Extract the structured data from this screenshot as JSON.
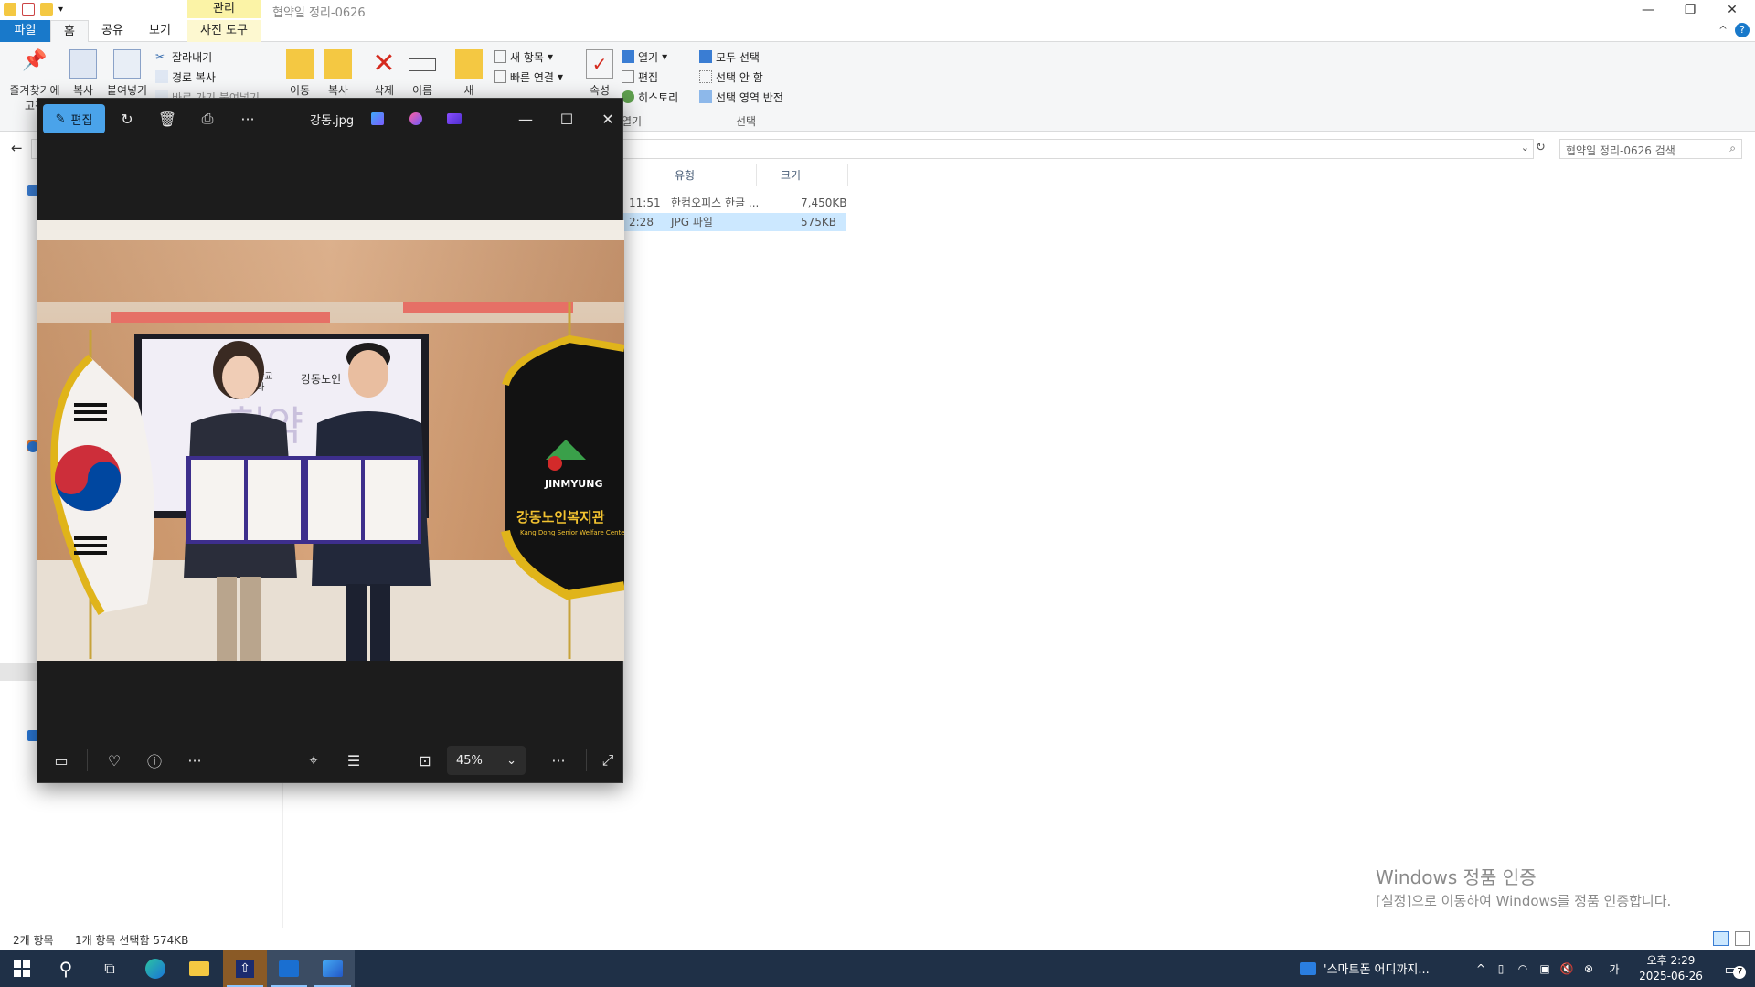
{
  "explorer": {
    "window_title": "협약일 정리-0626",
    "context_tab_header": "관리",
    "tabs": {
      "file": "파일",
      "home": "홈",
      "share": "공유",
      "view": "보기",
      "picture_tools": "사진 도구"
    },
    "ribbon": {
      "pin_quick_access": "즐겨찾기에 고정",
      "copy": "복사",
      "paste": "붙여넣기",
      "cut": "잘라내기",
      "copy_path": "경로 복사",
      "paste_shortcut": "바로 가기 붙여넣기",
      "move_to": "이동",
      "copy_to": "복사",
      "delete": "삭제",
      "rename": "이름",
      "new_folder": "새",
      "new_item": "새 항목",
      "easy_access": "빠른 연결",
      "properties": "속성",
      "open": "열기",
      "edit": "편집",
      "history": "히스토리",
      "open_group": "열기",
      "select_all": "모두 선택",
      "select_none": "선택 안 함",
      "invert_selection": "선택 영역 반전",
      "select_group": "선택"
    },
    "search_placeholder": "협약일 정리-0626 검색",
    "columns": {
      "type": "유형",
      "size": "크기"
    },
    "files": [
      {
        "time": "11:51",
        "type": "한컴오피스 한글 ...",
        "size": "7,450KB",
        "selected": false
      },
      {
        "time": "2:28",
        "type": "JPG 파일",
        "size": "575KB",
        "selected": true
      }
    ],
    "status": {
      "count": "2개 항목",
      "selection": "1개 항목 선택함 574KB"
    }
  },
  "watermark": {
    "line1": "Windows 정품 인증",
    "line2": "[설정]으로 이동하여 Windows를 정품 인증합니다."
  },
  "viewer": {
    "edit_label": "편집",
    "filename": "강동.jpg",
    "zoom": "45%"
  },
  "photo": {
    "banner_org": "강동노인",
    "banner_school": "대학교",
    "banner_dept": "학과",
    "banner_title": "협약",
    "pennant_logo": "JINMYUNG",
    "pennant_name": "강동노인복지관",
    "pennant_sub": "Kang Dong Senior Welfare Center"
  },
  "taskbar": {
    "news_text": "'스마트폰 어디까지...",
    "clock_time": "오후 2:29",
    "clock_date": "2025-06-26",
    "notification_count": "7"
  }
}
